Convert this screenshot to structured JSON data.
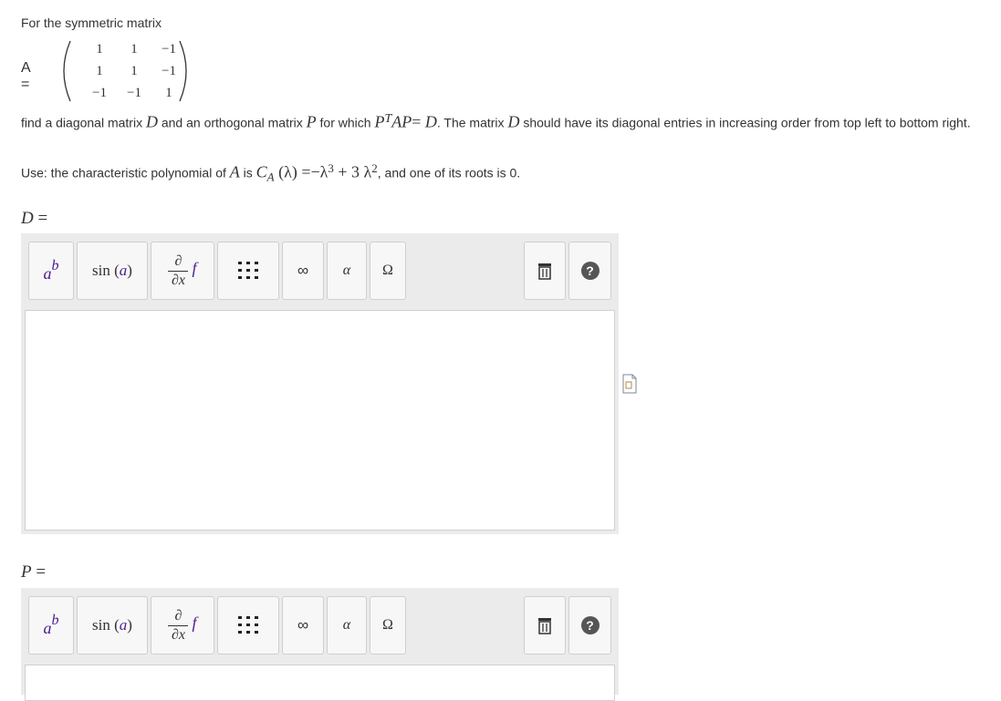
{
  "question": {
    "intro": "For the symmetric matrix",
    "matrix_label": "A =",
    "matrix": [
      [
        "1",
        "1",
        "−1"
      ],
      [
        "1",
        "1",
        "−1"
      ],
      [
        "−1",
        "−1",
        "1"
      ]
    ],
    "para1": {
      "t1": "find a diagonal matrix ",
      "D": "D",
      "t2": " and an orthogonal matrix ",
      "P": "P",
      "t3": " for which ",
      "ptap_P": "P",
      "ptap_T": "T",
      "ptap_AP": "AP",
      "eq": "= ",
      "D2": "D",
      "t4": ". The matrix ",
      "D3": "D",
      "t5": " should have its diagonal entries in increasing order from top left to bottom right."
    },
    "para2": {
      "t1": "Use:  the characteristic polynomial of ",
      "A": "A",
      "t2": " is ",
      "C": "C",
      "Csub": "A",
      "lparen": " (λ) =",
      "neg": "−λ",
      "exp3": "3",
      "plus": " + 3 λ",
      "exp2": "2",
      "t3": ", and one of its roots is 0."
    }
  },
  "answers": [
    {
      "var": "D",
      "eq": " ="
    },
    {
      "var": "P",
      "eq": " ="
    }
  ],
  "toolbar": {
    "power_base": "a",
    "power_exp": "b",
    "sin_label": "sin (",
    "sin_arg": "a",
    "sin_close": ")",
    "deriv_top": "∂",
    "deriv_bottom": "∂x",
    "deriv_f": "f",
    "infinity": "∞",
    "alpha": "α",
    "omega": "Ω",
    "help": "?"
  },
  "colors": {
    "purple": "#4b1d8f",
    "toolbar_bg": "#ebebeb",
    "help_bg": "#555555"
  }
}
